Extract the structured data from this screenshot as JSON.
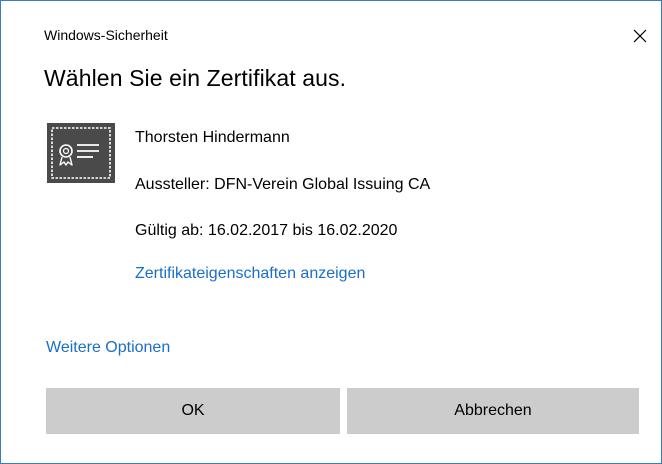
{
  "window": {
    "title": "Windows-Sicherheit",
    "close_icon": "close-icon"
  },
  "dialog": {
    "heading": "Wählen Sie ein Zertifikat aus."
  },
  "certificate": {
    "icon": "certificate-icon",
    "name": "Thorsten Hindermann",
    "issuer": "Aussteller: DFN-Verein Global Issuing CA",
    "validity": "Gültig ab: 16.02.2017 bis 16.02.2020",
    "properties_link": "Zertifikateigenschaften anzeigen"
  },
  "more_options_link": "Weitere Optionen",
  "buttons": {
    "ok": "OK",
    "cancel": "Abbrechen"
  },
  "colors": {
    "accent": "#1a6ec9",
    "border": "#3a7bc8",
    "button_bg": "#cccccc",
    "icon_bg": "#4a4a4a"
  }
}
